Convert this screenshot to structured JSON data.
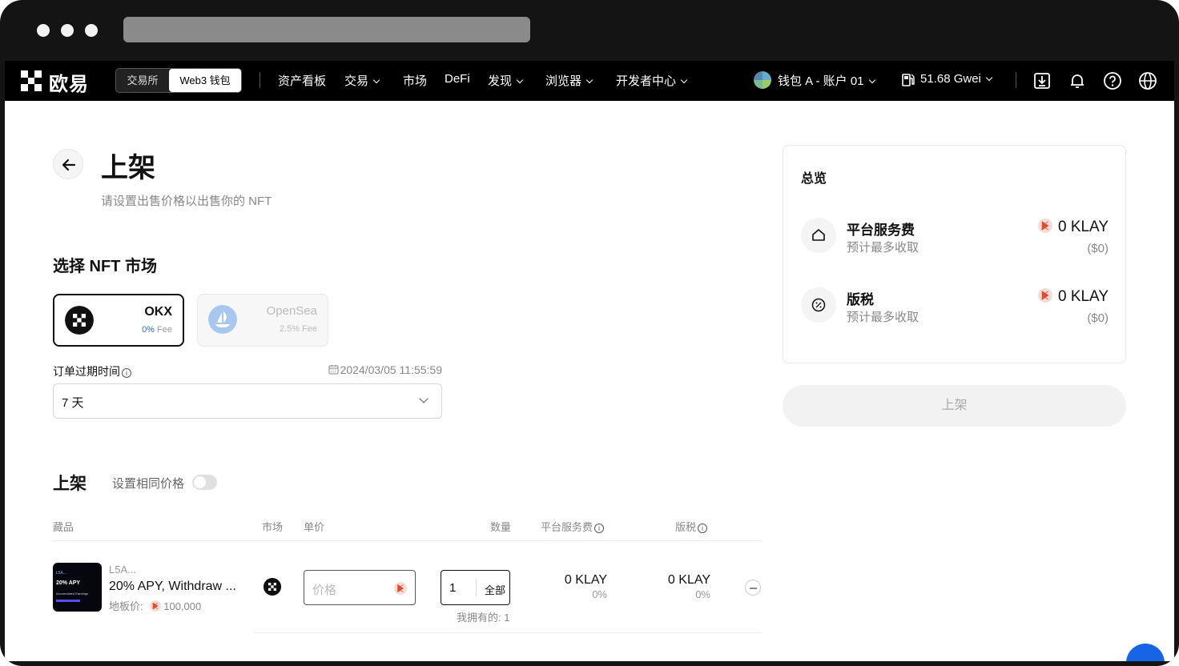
{
  "nav": {
    "logo_text": "欧易",
    "switch_exchange": "交易所",
    "switch_web3": "Web3 钱包",
    "links": [
      "资产看板",
      "交易",
      "市场",
      "DeFi",
      "发现",
      "浏览器",
      "开发者中心"
    ],
    "account": "钱包 A - 账户 01",
    "gas": "51.68 Gwei"
  },
  "page": {
    "title": "上架",
    "subtitle": "请设置出售价格以出售你的 NFT"
  },
  "market": {
    "heading": "选择 NFT 市场",
    "okx_name": "OKX",
    "okx_fee_pct": "0%",
    "okx_fee_label": "Fee",
    "opensea_name": "OpenSea",
    "opensea_fee": "2.5% Fee"
  },
  "expiry": {
    "label": "订单过期时间",
    "date": "2024/03/05 11:55:59",
    "selected": "7 天"
  },
  "listing": {
    "heading": "上架",
    "same_price_label": "设置相同价格",
    "columns": [
      "藏品",
      "市场",
      "单价",
      "数量",
      "平台服务费",
      "版税"
    ],
    "item": {
      "collection": "L5A...",
      "name": "20% APY, Withdraw ...",
      "floor_label": "地板价:",
      "floor_value": "100,000",
      "price_placeholder": "价格",
      "quantity": "1",
      "all_label": "全部",
      "owned": "我拥有的: 1",
      "platform_fee": "0 KLAY",
      "platform_fee_pct": "0%",
      "royalty": "0 KLAY",
      "royalty_pct": "0%",
      "thumb_line1": "L5A...",
      "thumb_line2": "20% APY",
      "thumb_line3": "Accumulated Earnings"
    }
  },
  "summary": {
    "title": "总览",
    "rows": [
      {
        "title": "平台服务费",
        "sub": "预计最多收取",
        "value": "0 KLAY",
        "usd": "($0)"
      },
      {
        "title": "版税",
        "sub": "预计最多收取",
        "value": "0 KLAY",
        "usd": "($0)"
      }
    ],
    "button": "上架"
  },
  "colors": {
    "accent": "#1565e6",
    "okx_fee": "#2a6bd8"
  }
}
